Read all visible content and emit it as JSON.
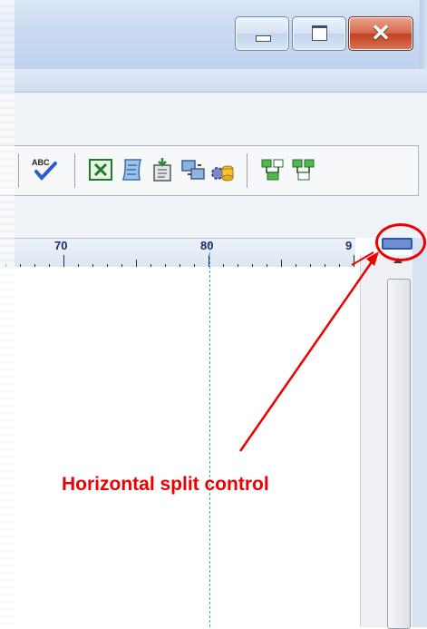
{
  "window": {
    "title_buttons": {
      "minimize_icon": "minimize-icon",
      "maximize_icon": "maximize-icon",
      "close_glyph": "✕"
    }
  },
  "toolbar": {
    "icons": [
      "spellcheck-icon",
      "excel-export-icon",
      "script-icon",
      "template-icon",
      "transfer-icon",
      "settings-icon",
      "split-view-icon",
      "compare-view-icon"
    ]
  },
  "ruler": {
    "labels": [
      "70",
      "80",
      "9"
    ]
  },
  "annotation": {
    "label": "Horizontal split control",
    "color": "#ee0000"
  }
}
